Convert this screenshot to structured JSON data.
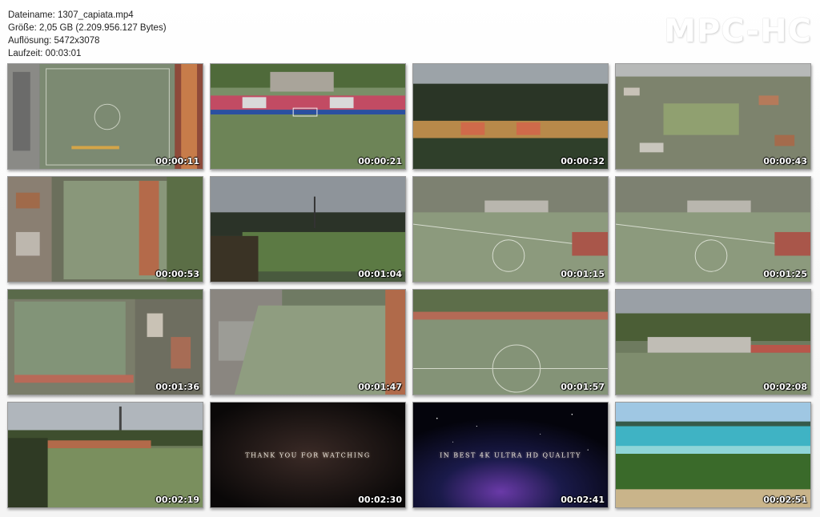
{
  "file_info": {
    "name": "Dateiname: 1307_capiata.mp4",
    "size": "Größe: 2,05 GB (2.209.956.127 Bytes)",
    "resolution": "Auflösung: 5472x3078",
    "duration": "Laufzeit: 00:03:01"
  },
  "brand": "MPC-HC",
  "thumbnails": [
    {
      "time": "00:00:11",
      "scene": "aerial-field-top"
    },
    {
      "time": "00:00:21",
      "scene": "stadium-grandstand"
    },
    {
      "time": "00:00:32",
      "scene": "stands-dark"
    },
    {
      "time": "00:00:43",
      "scene": "town-aerial-wide"
    },
    {
      "time": "00:00:53",
      "scene": "aerial-field-town"
    },
    {
      "time": "00:01:04",
      "scene": "dusk-field"
    },
    {
      "time": "00:01:15",
      "scene": "field-angled-town"
    },
    {
      "time": "00:01:25",
      "scene": "field-angled-town"
    },
    {
      "time": "00:01:36",
      "scene": "aerial-field-top-town"
    },
    {
      "time": "00:01:47",
      "scene": "aerial-field-oblique"
    },
    {
      "time": "00:01:57",
      "scene": "field-angled"
    },
    {
      "time": "00:02:08",
      "scene": "stadium-side-wide"
    },
    {
      "time": "00:02:19",
      "scene": "field-tower"
    },
    {
      "time": "00:02:30",
      "scene": "title-card-dark",
      "overlay": "THANK YOU FOR WATCHING",
      "overlay_sub": ""
    },
    {
      "time": "00:02:41",
      "scene": "title-card-space",
      "overlay": "IN BEST 4K ULTRA HD QUALITY"
    },
    {
      "time": "00:02:51",
      "scene": "beach-palms"
    }
  ]
}
